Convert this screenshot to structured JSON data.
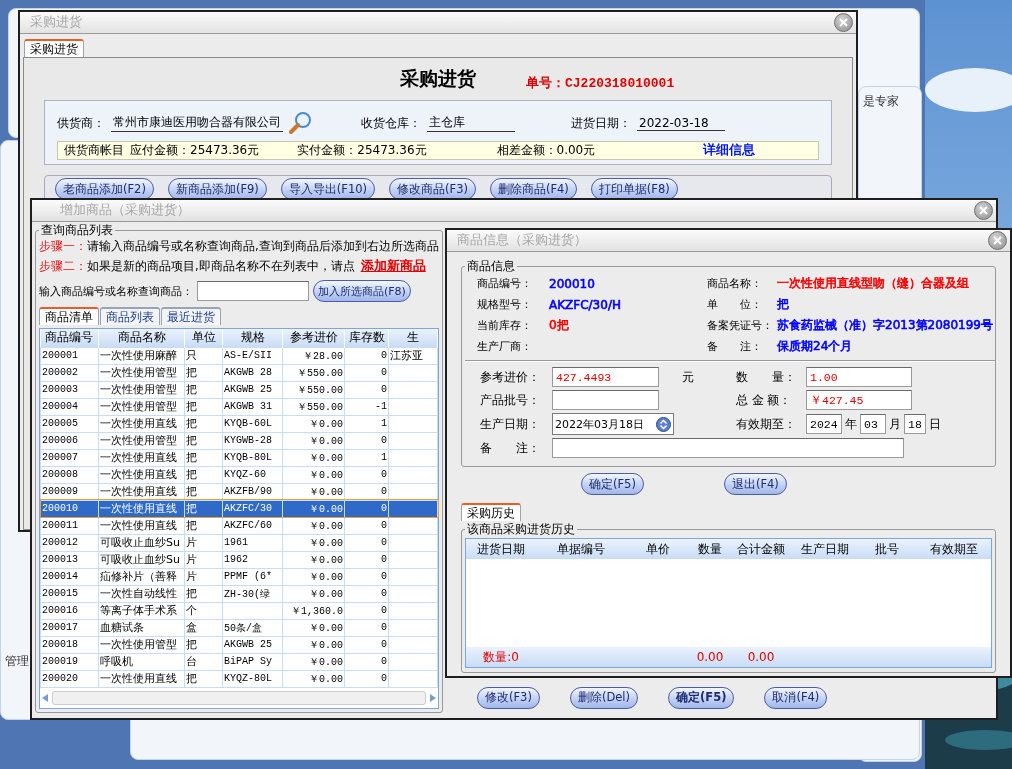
{
  "background": {
    "side_text": "是专家",
    "corner_text": "管理"
  },
  "purchase_window": {
    "title": "采购进货",
    "tab": {
      "label": "采购进货",
      "selected": true
    },
    "heading": "采购进货",
    "order_no": "单号：CJ220318010001",
    "supplier": {
      "label": "供货商：",
      "value": "常州市康迪医用吻合器有限公司"
    },
    "warehouse": {
      "label": "收货仓库：",
      "value": "主仓库"
    },
    "date": {
      "label": "进货日期：",
      "value": "2022-03-18"
    },
    "account": {
      "label": "供货商帐目",
      "payable": "应付金额：25473.36元",
      "paid": "实付金额：25473.36元",
      "difference": "相差金额：0.00元",
      "link": "详细信息"
    },
    "buttons": [
      "老商品添加(F2)",
      "新商品添加(F9)",
      "导入导出(F10)",
      "修改商品(F3)",
      "删除商品(F4)",
      "打印单据(F8)"
    ]
  },
  "add_window": {
    "title": "增加商品（采购进货）",
    "group_title": "查询商品列表",
    "step_1": {
      "label": "步骤一：",
      "text": "请输入商品编号或名称查询商品,查询到商品后添加到右边所选商品"
    },
    "step_2": {
      "label": "步骤二：",
      "text": "如果是新的商品项目,即商品名称不在列表中，请点",
      "link": "添加新商品"
    },
    "search": {
      "label": "输入商品编号或名称查询商品：",
      "button": "加入所选商品(F8)"
    },
    "tabs": [
      {
        "label": "商品清单",
        "selected": true
      },
      {
        "label": "商品列表",
        "selected": false
      },
      {
        "label": "最近进货",
        "selected": false
      }
    ],
    "product_table": {
      "columns": [
        "商品编号",
        "商品名称",
        "单位",
        "规格",
        "参考进价",
        "库存数",
        "生"
      ],
      "rows": [
        {
          "code": "200001",
          "name": "一次性使用麻醉",
          "unit": "只",
          "spec": "AS-E/SII",
          "price": "￥28.00",
          "stock": "0",
          "column_7": "江苏亚",
          "selected": false
        },
        {
          "code": "200002",
          "name": "一次性使用管型",
          "unit": "把",
          "spec": "AKGWB 28",
          "price": "￥550.00",
          "stock": "0",
          "selected": false
        },
        {
          "code": "200003",
          "name": "一次性使用管型",
          "unit": "把",
          "spec": "AKGWB 25",
          "price": "￥550.00",
          "stock": "0",
          "selected": false
        },
        {
          "code": "200004",
          "name": "一次性使用管型",
          "unit": "把",
          "spec": "AKGWB 31",
          "price": "￥550.00",
          "stock": "-1",
          "selected": false
        },
        {
          "code": "200005",
          "name": "一次性使用直线",
          "unit": "把",
          "spec": "KYQB-60L",
          "price": "￥0.00",
          "stock": "1",
          "selected": false
        },
        {
          "code": "200006",
          "name": "一次性使用管型",
          "unit": "把",
          "spec": "KYGWB-28",
          "price": "￥0.00",
          "stock": "0",
          "selected": false
        },
        {
          "code": "200007",
          "name": "一次性使用直线",
          "unit": "把",
          "spec": "KYQB-80L",
          "price": "￥0.00",
          "stock": "1",
          "selected": false
        },
        {
          "code": "200008",
          "name": "一次性使用直线",
          "unit": "把",
          "spec": "KYQZ-60",
          "price": "￥0.00",
          "stock": "0",
          "selected": false
        },
        {
          "code": "200009",
          "name": "一次性使用直线",
          "unit": "把",
          "spec": "AKZFB/90",
          "price": "￥0.00",
          "stock": "0",
          "selected": false
        },
        {
          "code": "200010",
          "name": "一次性使用直线",
          "unit": "把",
          "spec": "AKZFC/30",
          "price": "￥0.00",
          "stock": "0",
          "selected": true
        },
        {
          "code": "200011",
          "name": "一次性使用直线",
          "unit": "把",
          "spec": "AKZFC/60",
          "price": "￥0.00",
          "stock": "0",
          "selected": false
        },
        {
          "code": "200012",
          "name": "可吸收止血纱Su",
          "unit": "片",
          "spec": "1961",
          "price": "￥0.00",
          "stock": "0",
          "selected": false
        },
        {
          "code": "200013",
          "name": "可吸收止血纱Su",
          "unit": "片",
          "spec": "1962",
          "price": "￥0.00",
          "stock": "0",
          "selected": false
        },
        {
          "code": "200014",
          "name": "疝修补片（善释",
          "unit": "片",
          "spec": "PPMF (6*",
          "price": "￥0.00",
          "stock": "0",
          "selected": false
        },
        {
          "code": "200015",
          "name": "一次性自动线性",
          "unit": "把",
          "spec": "ZH-30(绿",
          "price": "￥0.00",
          "stock": "0",
          "selected": false
        },
        {
          "code": "200016",
          "name": "等离子体手术系",
          "unit": "个",
          "price": "￥1,360.0",
          "stock": "0",
          "selected": false
        },
        {
          "code": "200017",
          "name": "血糖试条",
          "unit": "盒",
          "spec": "50条/盒",
          "price": "￥0.00",
          "stock": "0",
          "selected": false
        },
        {
          "code": "200018",
          "name": "一次性使用管型",
          "unit": "把",
          "spec": "AKGWB 25",
          "price": "￥0.00",
          "stock": "0",
          "selected": false
        },
        {
          "code": "200019",
          "name": "呼吸机",
          "unit": "台",
          "spec": "BiPAP Sy",
          "price": "￥0.00",
          "stock": "0",
          "selected": false
        },
        {
          "code": "200020",
          "name": "一次性使用直线",
          "unit": "把",
          "spec": "KYQZ-80L",
          "price": "￥0.00",
          "stock": "0",
          "selected": false
        }
      ]
    },
    "buttons": [
      {
        "label": "修改(F3)",
        "default": false
      },
      {
        "label": "删除(Del)",
        "default": false
      },
      {
        "label": "确定(F5)",
        "default": true
      },
      {
        "label": "取消(F4)",
        "default": false
      }
    ]
  },
  "info_window": {
    "title": "商品信息（采购进货）",
    "group_title": "商品信息",
    "info": [
      {
        "label": "商品编号：",
        "value": "200010",
        "color": "#0000ff"
      },
      {
        "label": "商品名称：",
        "value": "一次性使用直线型吻（缝）合器及组",
        "color": "#ff0000"
      },
      {
        "label": "规格型号：",
        "value": "AKZFC/30/H",
        "color": "#0000ff"
      },
      {
        "label": "单　　位：",
        "value": "把",
        "color": "#0000ff"
      },
      {
        "label": "当前库存：",
        "value": "0把",
        "color": "#ff0000"
      },
      {
        "label": "备案凭证号：",
        "value": "苏食药监械（准）字2013第2080199号",
        "color": "#0000ff"
      },
      {
        "label": "生产厂商："
      },
      {
        "label": "备　　注：",
        "value": "保质期24个月",
        "color": "#0000ff"
      }
    ],
    "price": {
      "label": "参考进价：",
      "value": "427.4493",
      "unit": "元"
    },
    "quantity": {
      "label": "数　　量：",
      "value": "1.00"
    },
    "batch": {
      "label": "产品批号："
    },
    "total": {
      "label": "总 金 额：",
      "value": "￥427.45"
    },
    "production_date": {
      "label": "生产日期：",
      "value": "2022年03月18日"
    },
    "expiry": {
      "label": "有效期至：",
      "year": "2024",
      "year_unit": "年",
      "month": "03",
      "month_unit": "月",
      "day": "18",
      "day_unit": "日"
    },
    "remark": {
      "label": "备　　注："
    },
    "buttons": [
      "确定(F5)",
      "退出(F4)"
    ],
    "history_tab": {
      "label": "采购历史",
      "selected": true
    },
    "history_group": "该商品采购进货历史",
    "history_columns": [
      "进货日期",
      "单据编号",
      "单价",
      "数量",
      "合计金额",
      "生产日期",
      "批号",
      "有效期至"
    ],
    "history_footer": {
      "count": "数量:0",
      "quantity_total": "0.00",
      "amount_total": "0.00"
    }
  }
}
